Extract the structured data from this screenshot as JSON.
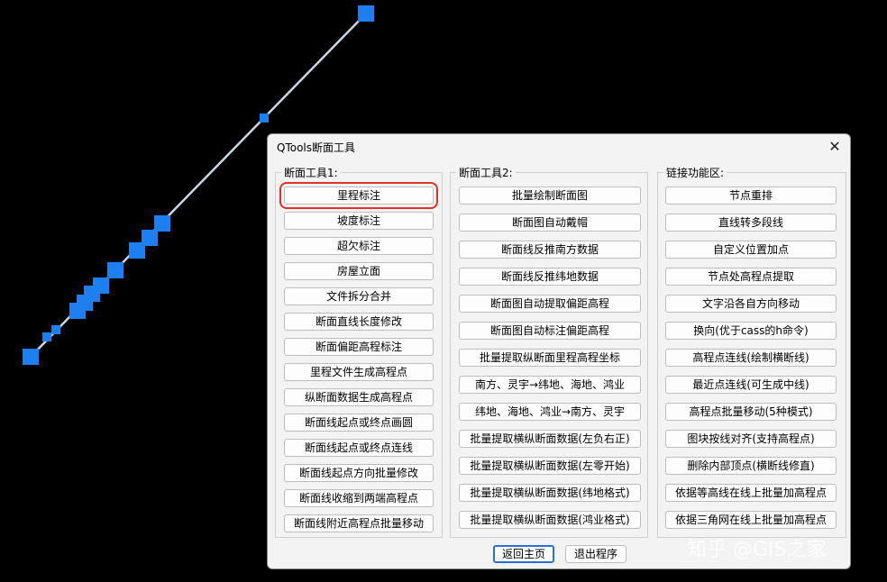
{
  "dialog": {
    "title": "QTools断面工具",
    "close_symbol": "✕"
  },
  "group1": {
    "label": "断面工具1:",
    "buttons": [
      "里程标注",
      "坡度标注",
      "超欠标注",
      "房屋立面",
      "文件拆分合并",
      "断面直线长度修改",
      "断面偏距高程标注",
      "里程文件生成高程点",
      "纵断面数据生成高程点",
      "断面线起点或终点画圆",
      "断面线起点或终点连线",
      "断面线起点方向批量修改",
      "断面线收缩到两端高程点",
      "断面线附近高程点批量移动"
    ]
  },
  "group2": {
    "label": "断面工具2:",
    "buttons": [
      "批量绘制断面图",
      "断面图自动戴帽",
      "断面线反推南方数据",
      "断面线反推纬地数据",
      "断面图自动提取偏距高程",
      "断面图自动标注偏距高程",
      "批量提取纵断面里程高程坐标",
      "南方、灵宇→纬地、海地、鸿业",
      "纬地、海地、鸿业→南方、灵宇",
      "批量提取横纵断面数据(左负右正)",
      "批量提取横纵断面数据(左零开始)",
      "批量提取横纵断面数据(纬地格式)",
      "批量提取横纵断面数据(鸿业格式)"
    ]
  },
  "group3": {
    "label": "链接功能区:",
    "buttons": [
      "节点重排",
      "直线转多段线",
      "自定义位置加点",
      "节点处高程点提取",
      "文字沿各自方向移动",
      "换向(优于cass的h命令)",
      "高程点连线(绘制横断线)",
      "最近点连线(可生成中线)",
      "高程点批量移动(5种模式)",
      "图块按线对齐(支持高程点)",
      "删除内部顶点(横断线修直)",
      "依据等高线在线上批量加高程点",
      "依据三角网在线上批量加高程点"
    ]
  },
  "footer": {
    "back_label": "返回主页",
    "exit_label": "退出程序"
  },
  "watermark": "知乎 @GIS之家",
  "colors": {
    "background": "#000000",
    "cad_line": "#c8d6e6",
    "grip": "#1e7ff0",
    "highlight": "#e0302a",
    "primary_border": "#2b6fd6"
  },
  "highlighted_button": "里程标注"
}
